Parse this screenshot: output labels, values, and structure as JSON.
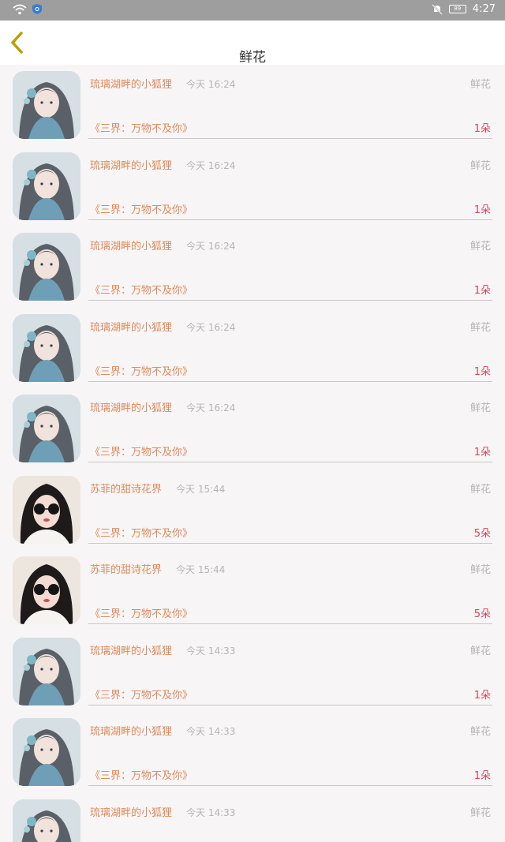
{
  "status_bar": {
    "time": "4:27",
    "battery": "89"
  },
  "header": {
    "title": "鲜花"
  },
  "colors": {
    "accent": "#e08a5a",
    "count": "#d0485a",
    "muted": "#b5b5b5",
    "back_arrow": "#b8a000"
  },
  "gifts": [
    {
      "sender": "琉璃湖畔的小狐狸",
      "time": "今天 16:24",
      "type": "鲜花",
      "book": "《三界：万物不及你》",
      "count": "1朵",
      "avatar": "anime-girl"
    },
    {
      "sender": "琉璃湖畔的小狐狸",
      "time": "今天 16:24",
      "type": "鲜花",
      "book": "《三界：万物不及你》",
      "count": "1朵",
      "avatar": "anime-girl"
    },
    {
      "sender": "琉璃湖畔的小狐狸",
      "time": "今天 16:24",
      "type": "鲜花",
      "book": "《三界：万物不及你》",
      "count": "1朵",
      "avatar": "anime-girl"
    },
    {
      "sender": "琉璃湖畔的小狐狸",
      "time": "今天 16:24",
      "type": "鲜花",
      "book": "《三界：万物不及你》",
      "count": "1朵",
      "avatar": "anime-girl"
    },
    {
      "sender": "琉璃湖畔的小狐狸",
      "time": "今天 16:24",
      "type": "鲜花",
      "book": "《三界：万物不及你》",
      "count": "1朵",
      "avatar": "anime-girl"
    },
    {
      "sender": "苏菲的甜诗花界",
      "time": "今天 15:44",
      "type": "鲜花",
      "book": "《三界：万物不及你》",
      "count": "5朵",
      "avatar": "sunglasses-woman"
    },
    {
      "sender": "苏菲的甜诗花界",
      "time": "今天 15:44",
      "type": "鲜花",
      "book": "《三界：万物不及你》",
      "count": "5朵",
      "avatar": "sunglasses-woman"
    },
    {
      "sender": "琉璃湖畔的小狐狸",
      "time": "今天 14:33",
      "type": "鲜花",
      "book": "《三界：万物不及你》",
      "count": "1朵",
      "avatar": "anime-girl"
    },
    {
      "sender": "琉璃湖畔的小狐狸",
      "time": "今天 14:33",
      "type": "鲜花",
      "book": "《三界：万物不及你》",
      "count": "1朵",
      "avatar": "anime-girl"
    },
    {
      "sender": "琉璃湖畔的小狐狸",
      "time": "今天 14:33",
      "type": "鲜花",
      "book": "",
      "count": "",
      "avatar": "anime-girl"
    }
  ]
}
